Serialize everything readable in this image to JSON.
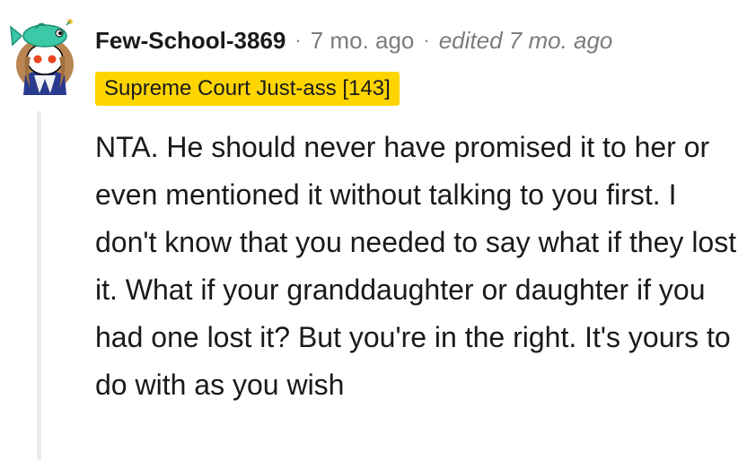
{
  "comment": {
    "username": "Few-School-3869",
    "separator": "·",
    "time": "7 mo. ago",
    "edited": "edited 7 mo. ago",
    "flair": "Supreme Court Just-ass [143]",
    "body": "NTA. He should never have promised it to her or even mentioned it without talking to you first. I don't know that you needed to say what if they lost it. What if your granddaughter or daughter if you had one lost it? But you're in the right. It's yours to do with as you wish",
    "avatar_icon": "snoo-avatar-icon"
  },
  "colors": {
    "flair_background": "#ffd500",
    "username": "#1a1a1b",
    "meta_gray": "#7c7c7c",
    "thread_line": "#e9ebed"
  }
}
